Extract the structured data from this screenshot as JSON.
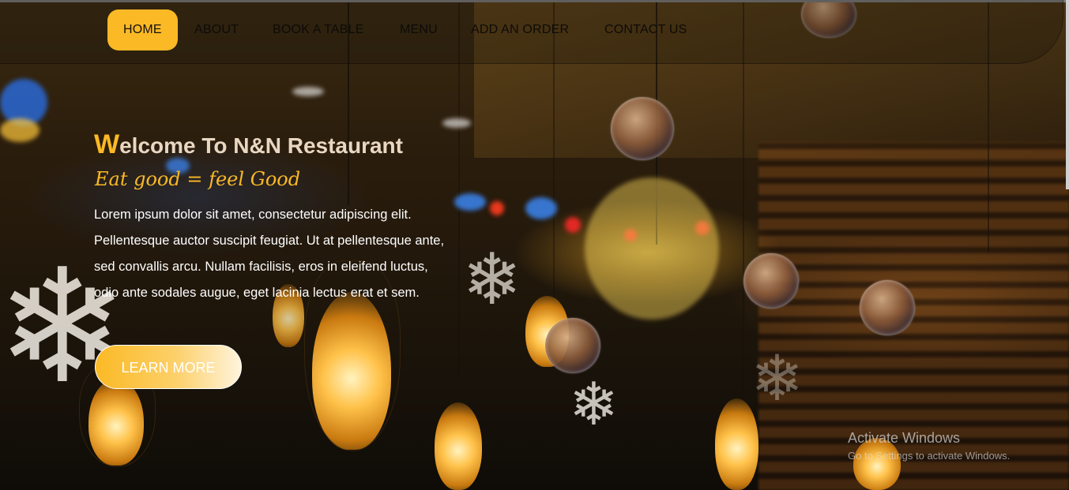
{
  "nav": {
    "items": [
      {
        "label": "HOME",
        "active": true
      },
      {
        "label": "ABOUT",
        "active": false
      },
      {
        "label": "BOOK A TABLE",
        "active": false
      },
      {
        "label": "MENU",
        "active": false
      },
      {
        "label": "ADD AN ORDER",
        "active": false
      },
      {
        "label": "CONTACT US",
        "active": false
      }
    ]
  },
  "hero": {
    "title_first_letter": "W",
    "title_rest": "elcome To N&N Restaurant",
    "tagline": "Eat good = feel Good",
    "description": "Lorem ipsum dolor sit amet, consectetur adipiscing elit. Pellentesque auctor suscipit feugiat. Ut at pellentesque ante, sed convallis arcu. Nullam facilisis, eros in eleifend luctus, odio ante sodales augue, eget lacinia lectus erat et sem.",
    "button_label": "LEARN MORE"
  },
  "watermark": {
    "title": "Activate Windows",
    "subtitle": "Go to Settings to activate Windows."
  },
  "colors": {
    "accent": "#fbb925",
    "title_text": "#e9d7c2"
  }
}
